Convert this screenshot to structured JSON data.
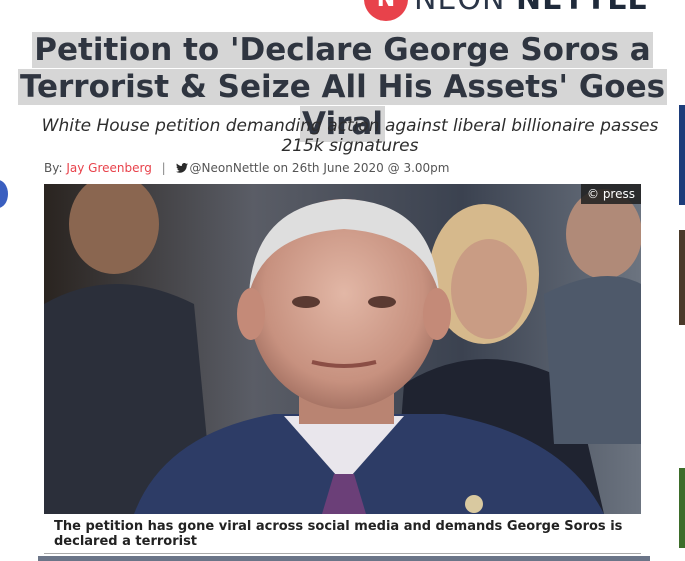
{
  "site": {
    "logo_mark": "N",
    "logo_word_1": "NEON",
    "logo_word_2": "NETTLE"
  },
  "article": {
    "headline_line1": "Petition to 'Declare George Soros a",
    "headline_line2": "Terrorist & Seize All His Assets' Goes Viral",
    "subheadline": "White House petition demanding action against liberal billionaire passes 215k signatures",
    "byline_prefix": "By:",
    "author": "Jay Greenberg",
    "twitter_handle": "@NeonNettle",
    "date_text": "on 26th June 2020 @ 3.00pm",
    "photo_credit": "© press",
    "caption": "The petition has gone viral across social media and demands George Soros is declared a terrorist"
  },
  "colors": {
    "accent": "#e8424b",
    "headline_highlight": "#d6d6d6"
  }
}
